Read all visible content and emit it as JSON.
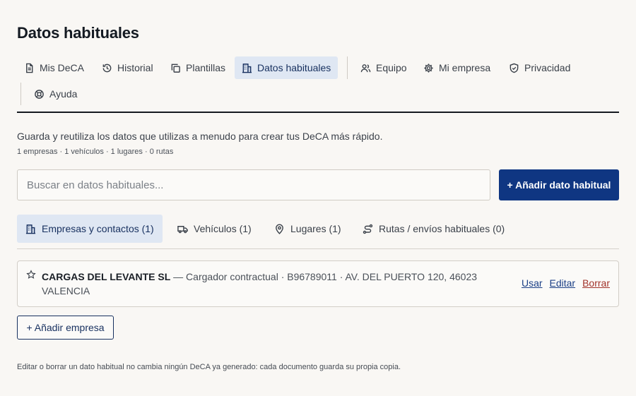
{
  "page": {
    "title": "Datos habituales"
  },
  "nav": {
    "items": [
      {
        "label": "Mis DeCA",
        "icon": "document-icon"
      },
      {
        "label": "Historial",
        "icon": "history-icon"
      },
      {
        "label": "Plantillas",
        "icon": "copy-icon"
      },
      {
        "label": "Datos habituales",
        "icon": "building-icon",
        "active": true
      },
      {
        "label": "Equipo",
        "icon": "users-icon"
      },
      {
        "label": "Mi empresa",
        "icon": "gear-icon"
      },
      {
        "label": "Privacidad",
        "icon": "shield-icon"
      },
      {
        "label": "Ayuda",
        "icon": "lifebuoy-icon"
      }
    ]
  },
  "intro": {
    "description": "Guarda y reutiliza los datos que utilizas a menudo para crear tus DeCA más rápido.",
    "counts": "1 empresas · 1 vehículos · 1 lugares · 0 rutas"
  },
  "search": {
    "placeholder": "Buscar en datos habituales...",
    "value": ""
  },
  "toolbar": {
    "add_label": "+ Añadir dato habitual"
  },
  "subtabs": [
    {
      "label": "Empresas y contactos (1)",
      "icon": "building-icon",
      "active": true
    },
    {
      "label": "Vehículos (1)",
      "icon": "truck-icon"
    },
    {
      "label": "Lugares (1)",
      "icon": "map-pin-icon"
    },
    {
      "label": "Rutas / envíos habituales (0)",
      "icon": "route-icon"
    }
  ],
  "records": [
    {
      "name": "CARGAS DEL LEVANTE SL",
      "details": " — Cargador contractual · B96789011 · AV. DEL PUERTO 120, 46023 VALENCIA",
      "actions": {
        "use": "Usar",
        "edit": "Editar",
        "delete": "Borrar"
      }
    }
  ],
  "add_company_label": "+ Añadir empresa",
  "footnote": "Editar o borrar un dato habitual no cambia ningún DeCA ya generado: cada documento guarda su propia copia.",
  "colors": {
    "accent": "#0f3682",
    "active_tab_bg": "#dfe7f3",
    "danger": "#a2322a",
    "background": "#f9f7f4"
  }
}
